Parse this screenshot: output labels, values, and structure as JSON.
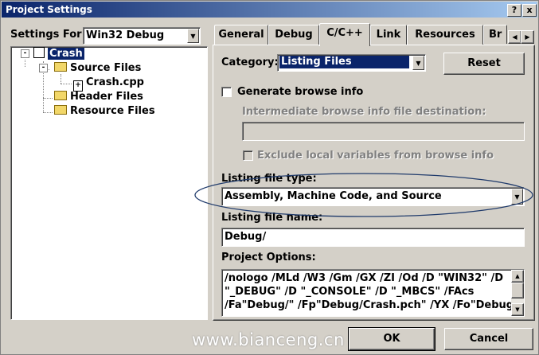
{
  "window": {
    "title": "Project Settings",
    "help_btn": "?",
    "close_btn": "x"
  },
  "left": {
    "settings_for_label": "Settings For:",
    "settings_for_value": "Win32 Debug",
    "tree": [
      {
        "label": "Crash",
        "icon": "project-icon",
        "selected": true,
        "expander": "-"
      },
      {
        "label": "Source Files",
        "icon": "folder-icon",
        "expander": "-"
      },
      {
        "label": "Crash.cpp",
        "icon": "file-icon"
      },
      {
        "label": "Header Files",
        "icon": "folder-icon"
      },
      {
        "label": "Resource Files",
        "icon": "folder-icon"
      }
    ]
  },
  "tabs": [
    {
      "label": "General"
    },
    {
      "label": "Debug"
    },
    {
      "label": "C/C++",
      "active": true
    },
    {
      "label": "Link"
    },
    {
      "label": "Resources"
    },
    {
      "label": "Br"
    }
  ],
  "category": {
    "label": "Category:",
    "value": "Listing Files",
    "reset_label": "Reset"
  },
  "browse": {
    "generate_label": "Generate browse info",
    "generate_checked": false,
    "dest_label": "Intermediate browse info file destination:",
    "dest_value": "",
    "exclude_label": "Exclude local variables from browse info",
    "exclude_checked": false
  },
  "listing": {
    "type_label": "Listing file type:",
    "type_value": "Assembly, Machine Code, and Source",
    "name_label": "Listing file name:",
    "name_value": "Debug/"
  },
  "options": {
    "label": "Project Options:",
    "lines": [
      "/nologo /MLd /W3 /Gm /GX /ZI /Od /D \"WIN32\" /D",
      "\"_DEBUG\" /D \"_CONSOLE\" /D \"_MBCS\" /FAcs",
      "/Fa\"Debug/\" /Fp\"Debug/Crash.pch\" /YX /Fo\"Debug/\""
    ]
  },
  "buttons": {
    "ok": "OK",
    "cancel": "Cancel"
  },
  "watermark": "www.bianceng.cn",
  "colors": {
    "titlebar": "#0a246a",
    "selection": "#0a246a",
    "annotation_ellipse": "#1f3a6b"
  }
}
